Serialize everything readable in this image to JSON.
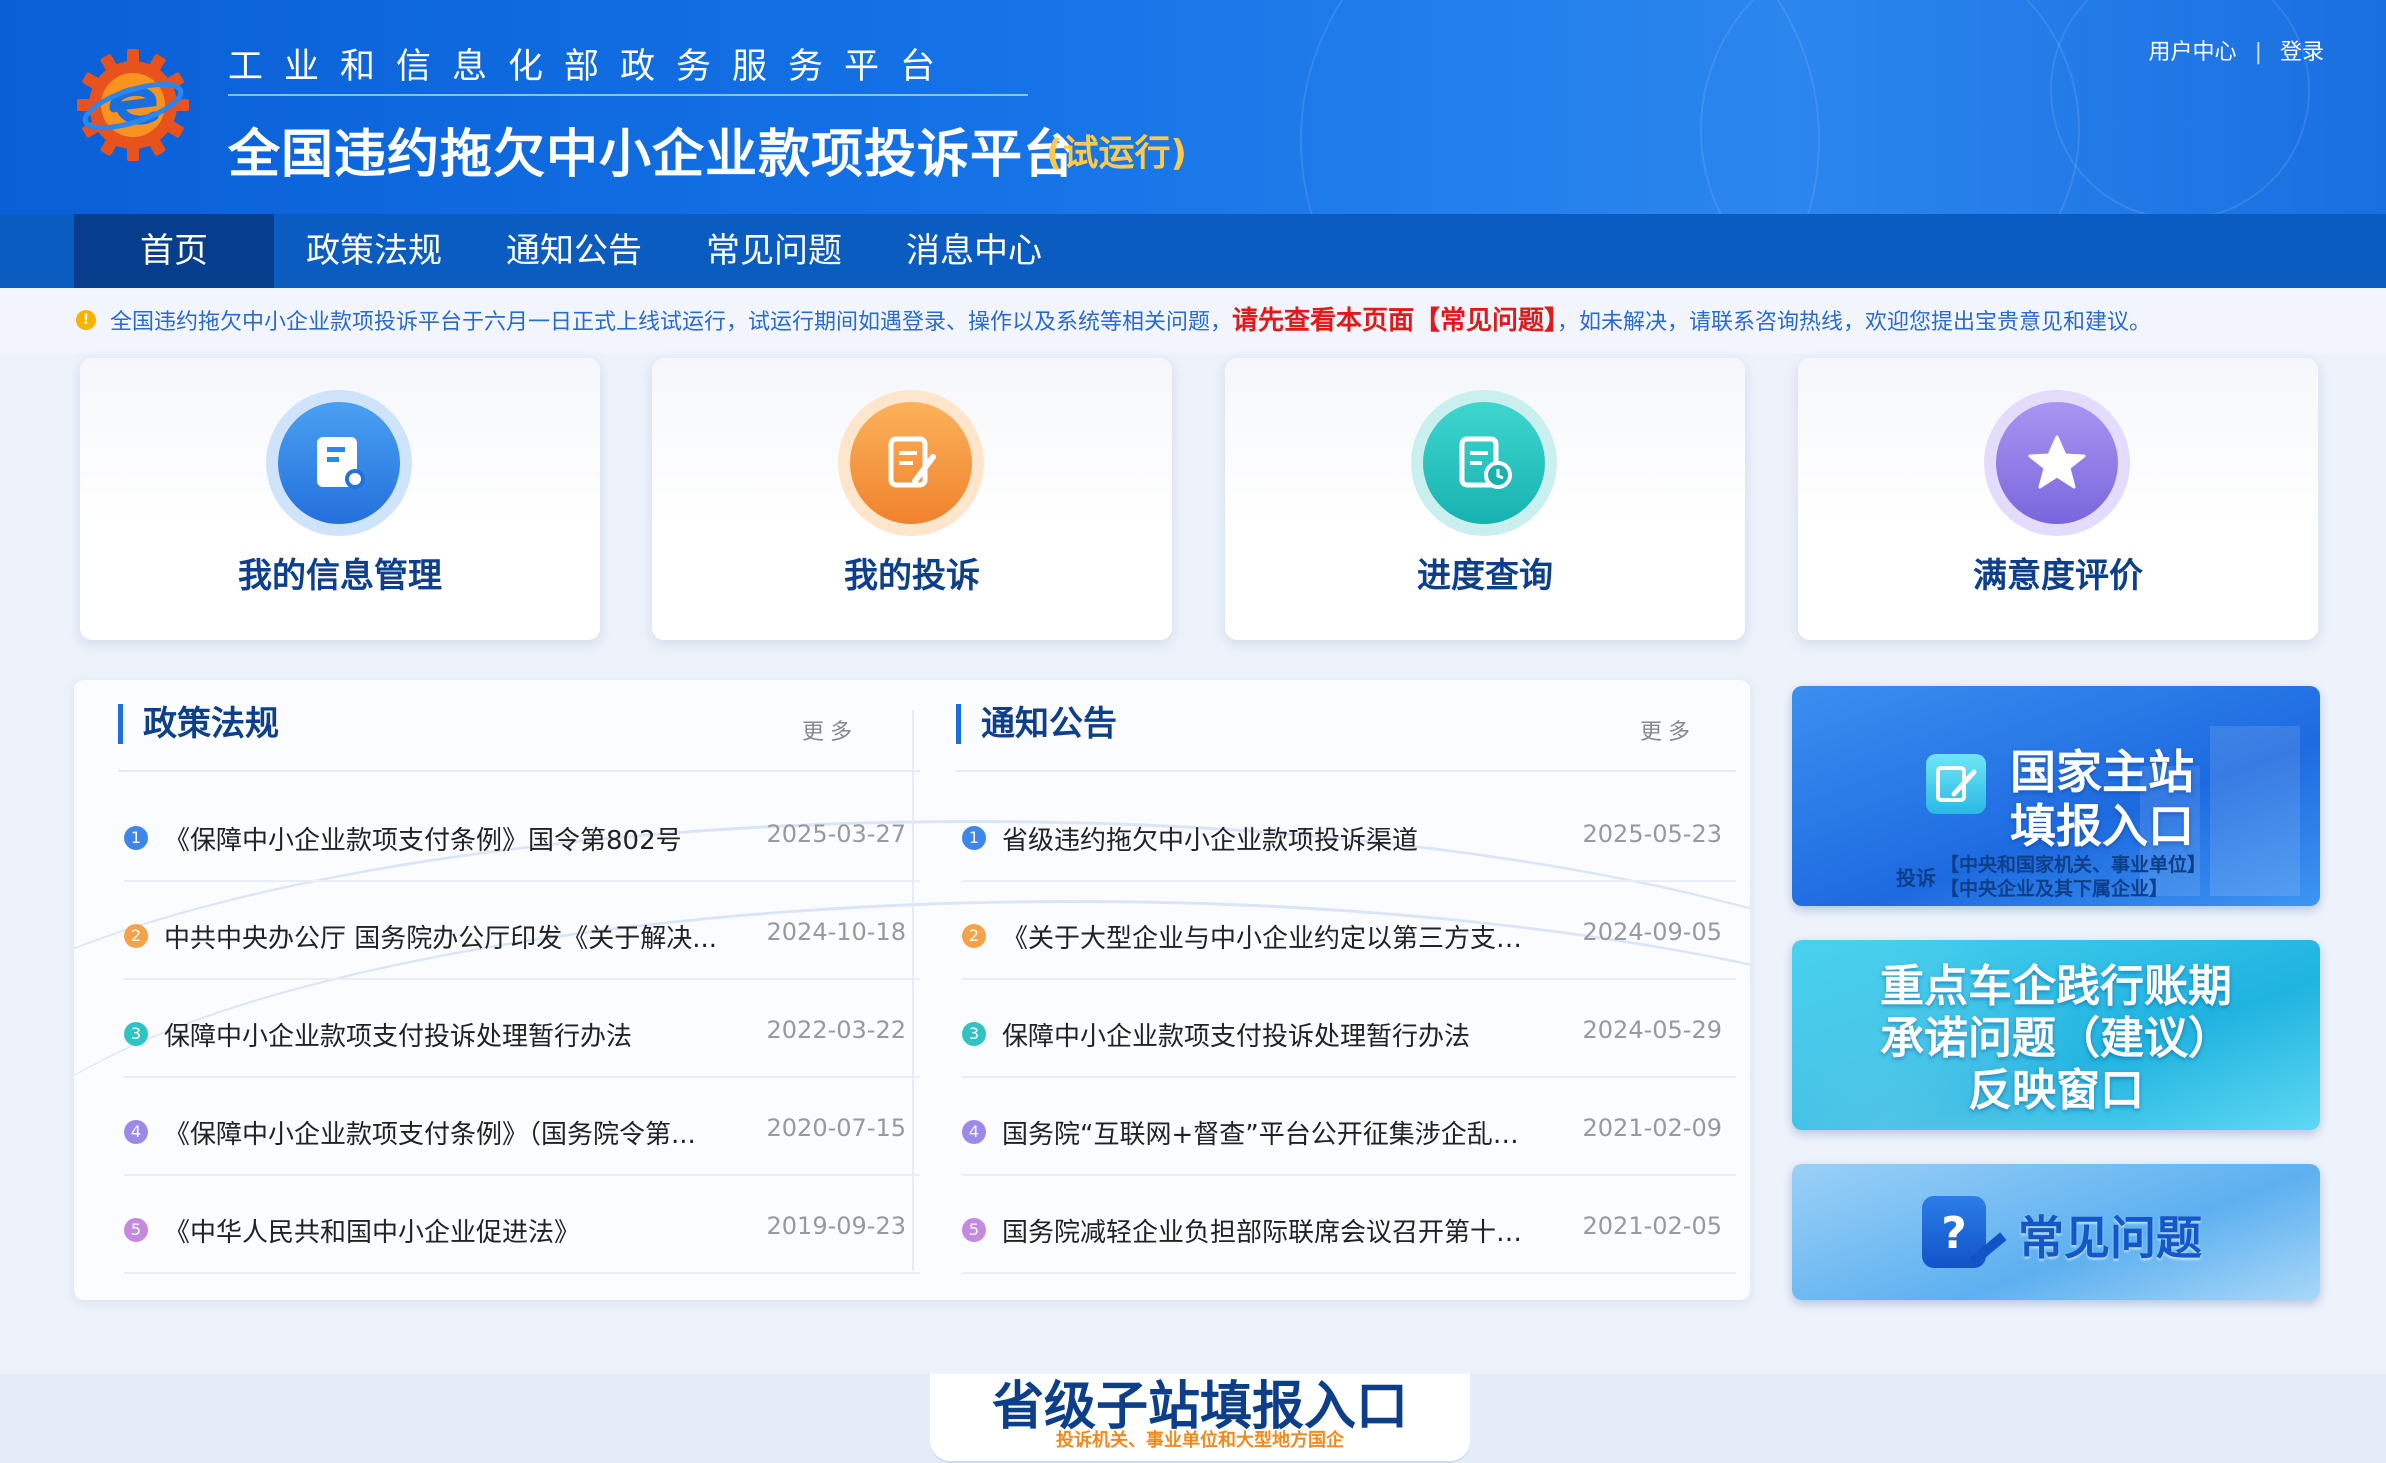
{
  "header": {
    "gov_title": "工业和信息化部政务服务平台",
    "main_title": "全国违约拖欠中小企业款项投诉平台",
    "trial_label": "(试运行)",
    "user_center": "用户中心",
    "separator": "|",
    "login": "登录"
  },
  "nav": {
    "items": [
      {
        "label": "首页",
        "active": true
      },
      {
        "label": "政策法规"
      },
      {
        "label": "通知公告"
      },
      {
        "label": "常见问题"
      },
      {
        "label": "消息中心"
      }
    ]
  },
  "notice": {
    "icon": "!",
    "text_before": "全国违约拖欠中小企业款项投诉平台于六月一日正式上线试运行，试运行期间如遇登录、操作以及系统等相关问题，",
    "highlight": "请先查看本页面【常见问题】",
    "text_after": "，如未解决，请联系咨询热线，欢迎您提出宝贵意见和建议。"
  },
  "cards": [
    {
      "label": "我的信息管理",
      "icon": "profile-icon",
      "color": "#2d86e8"
    },
    {
      "label": "我的投诉",
      "icon": "complaint-icon",
      "color": "#f59a3c"
    },
    {
      "label": "进度查询",
      "icon": "progress-icon",
      "color": "#22c2c0"
    },
    {
      "label": "满意度评价",
      "icon": "star-icon",
      "color": "#8c7be8"
    }
  ],
  "policy": {
    "title": "政策法规",
    "more": "更多",
    "items": [
      {
        "n": "1",
        "title": "《保障中小企业款项支付条例》国令第802号",
        "date": "2025-03-27"
      },
      {
        "n": "2",
        "title": "中共中央办公厅 国务院办公厅印发《关于解决...",
        "date": "2024-10-18"
      },
      {
        "n": "3",
        "title": "保障中小企业款项支付投诉处理暂行办法",
        "date": "2022-03-22"
      },
      {
        "n": "4",
        "title": "《保障中小企业款项支付条例》（国务院令第...",
        "date": "2020-07-15"
      },
      {
        "n": "5",
        "title": "《中华人民共和国中小企业促进法》",
        "date": "2019-09-23"
      }
    ]
  },
  "notices": {
    "title": "通知公告",
    "more": "更多",
    "items": [
      {
        "n": "1",
        "title": "省级违约拖欠中小企业款项投诉渠道",
        "date": "2025-05-23"
      },
      {
        "n": "2",
        "title": "《关于大型企业与中小企业约定以第三方支付...",
        "date": "2024-09-05"
      },
      {
        "n": "3",
        "title": "保障中小企业款项支付投诉处理暂行办法",
        "date": "2024-05-29"
      },
      {
        "n": "4",
        "title": "国务院“互联网+督查”平台公开征集涉企乱收费...",
        "date": "2021-02-09"
      },
      {
        "n": "5",
        "title": "国务院减轻企业负担部际联席会议召开第十次...",
        "date": "2021-02-05"
      }
    ]
  },
  "number_colors": [
    "#3f86ea",
    "#f5a24b",
    "#2fc4c4",
    "#9c8ae8",
    "#c38ae0"
  ],
  "side": {
    "national_line1": "国家主站",
    "national_line2": "填报入口",
    "national_complaint": "投诉",
    "national_sub1": "【中央和国家机关、事业单位】",
    "national_sub2": "【中央企业及其下属企业】",
    "car_line1": "重点车企践行账期",
    "car_line2": "承诺问题（建议）",
    "car_line3": "反映窗口",
    "faq": "常见问题"
  },
  "province": {
    "title": "省级子站填报入口",
    "sub": "投诉机关、事业单位和大型地方国企"
  }
}
